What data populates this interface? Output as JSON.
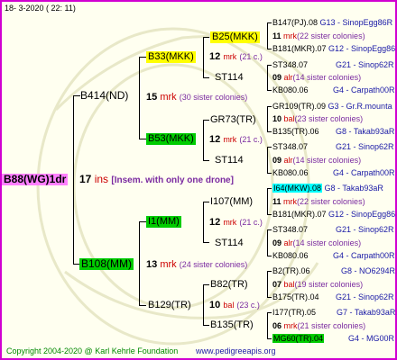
{
  "header": {
    "date": "18-  3-2020 ( 22: 11)"
  },
  "footer": {
    "copyright": "Copyright 2004-2020 @ Karl Kehrle Foundation",
    "url": "www.pedigreeapis.org"
  },
  "queen": {
    "name": "B88(WG)1dr",
    "count": "17",
    "mark": "ins",
    "note": "[Insem. with only one drone]"
  },
  "gen1": {
    "top": {
      "name": "B414(ND)",
      "count": "15",
      "mark": "mrk",
      "note": "(30 sister colonies)"
    },
    "bottom": {
      "name": "B108(MM)",
      "count": "13",
      "mark": "mrk",
      "note": "(24 sister colonies)"
    }
  },
  "gen2": {
    "a": {
      "name": "B33(MKK)",
      "count": "12",
      "mark": "mrk",
      "note": "(21 c.)"
    },
    "b": {
      "name": "B53(MKK)",
      "count": "12",
      "mark": "mrk",
      "note": "(21 c.)"
    },
    "c": {
      "name": "I1(MM)",
      "count": "12",
      "mark": "mrk",
      "note": "(21 c.)"
    },
    "d": {
      "name": "B129(TR)",
      "count": "10",
      "mark": "bal",
      "note": "(23 c.)"
    }
  },
  "gen3": {
    "a1": {
      "name": "B25(MKK)",
      "count": "11",
      "mark": "mrk",
      "note": "(22 sister colonies)",
      "top": "B147(PJ).08",
      "top_loc": "G13 - SinopEgg86R",
      "bot": "B181(MKR).07",
      "bot_loc": "G12 - SinopEgg86R"
    },
    "a2": {
      "name": "ST114",
      "count": "09",
      "mark": "alr",
      "note": "(14 sister colonies)",
      "top": "ST348.07",
      "top_loc": "G21 - Sinop62R",
      "bot": "KB080.06",
      "bot_loc": "G4 - Carpath00R"
    },
    "b1": {
      "name": "GR73(TR)",
      "count": "10",
      "mark": "bal",
      "note": "(23 sister colonies)",
      "top": "GR109(TR).09",
      "top_loc": "G3 - Gr.R.mounta",
      "bot": "B135(TR).06",
      "bot_loc": "G8 - Takab93aR"
    },
    "b2": {
      "name": "ST114",
      "count": "09",
      "mark": "alr",
      "note": "(14 sister colonies)",
      "top": "ST348.07",
      "top_loc": "G21 - Sinop62R",
      "bot": "KB080.06",
      "bot_loc": "G4 - Carpath00R"
    },
    "c1": {
      "name": "I107(MM)",
      "count": "11",
      "mark": "mrk",
      "note": "(22 sister colonies)",
      "top": "I64(MKW).08",
      "top_loc": "G8 - Takab93aR",
      "bot": "B181(MKR).07",
      "bot_loc": "G12 - SinopEgg86R"
    },
    "c2": {
      "name": "ST114",
      "count": "09",
      "mark": "alr",
      "note": "(14 sister colonies)",
      "top": "ST348.07",
      "top_loc": "G21 - Sinop62R",
      "bot": "KB080.06",
      "bot_loc": "G4 - Carpath00R"
    },
    "d1": {
      "name": "B82(TR)",
      "count": "07",
      "mark": "bal",
      "note": "(19 sister colonies)",
      "top": "B2(TR).06",
      "top_loc": "G8 - NO6294R",
      "bot": "B175(TR).04",
      "bot_loc": "G21 - Sinop62R"
    },
    "d2": {
      "name": "B135(TR)",
      "count": "06",
      "mark": "mrk",
      "note": "(21 sister colonies)",
      "top": "I177(TR).05",
      "top_loc": "G7 - Takab93aR",
      "bot": "MG60(TR).04",
      "bot_loc": "G4 - MG00R"
    }
  }
}
